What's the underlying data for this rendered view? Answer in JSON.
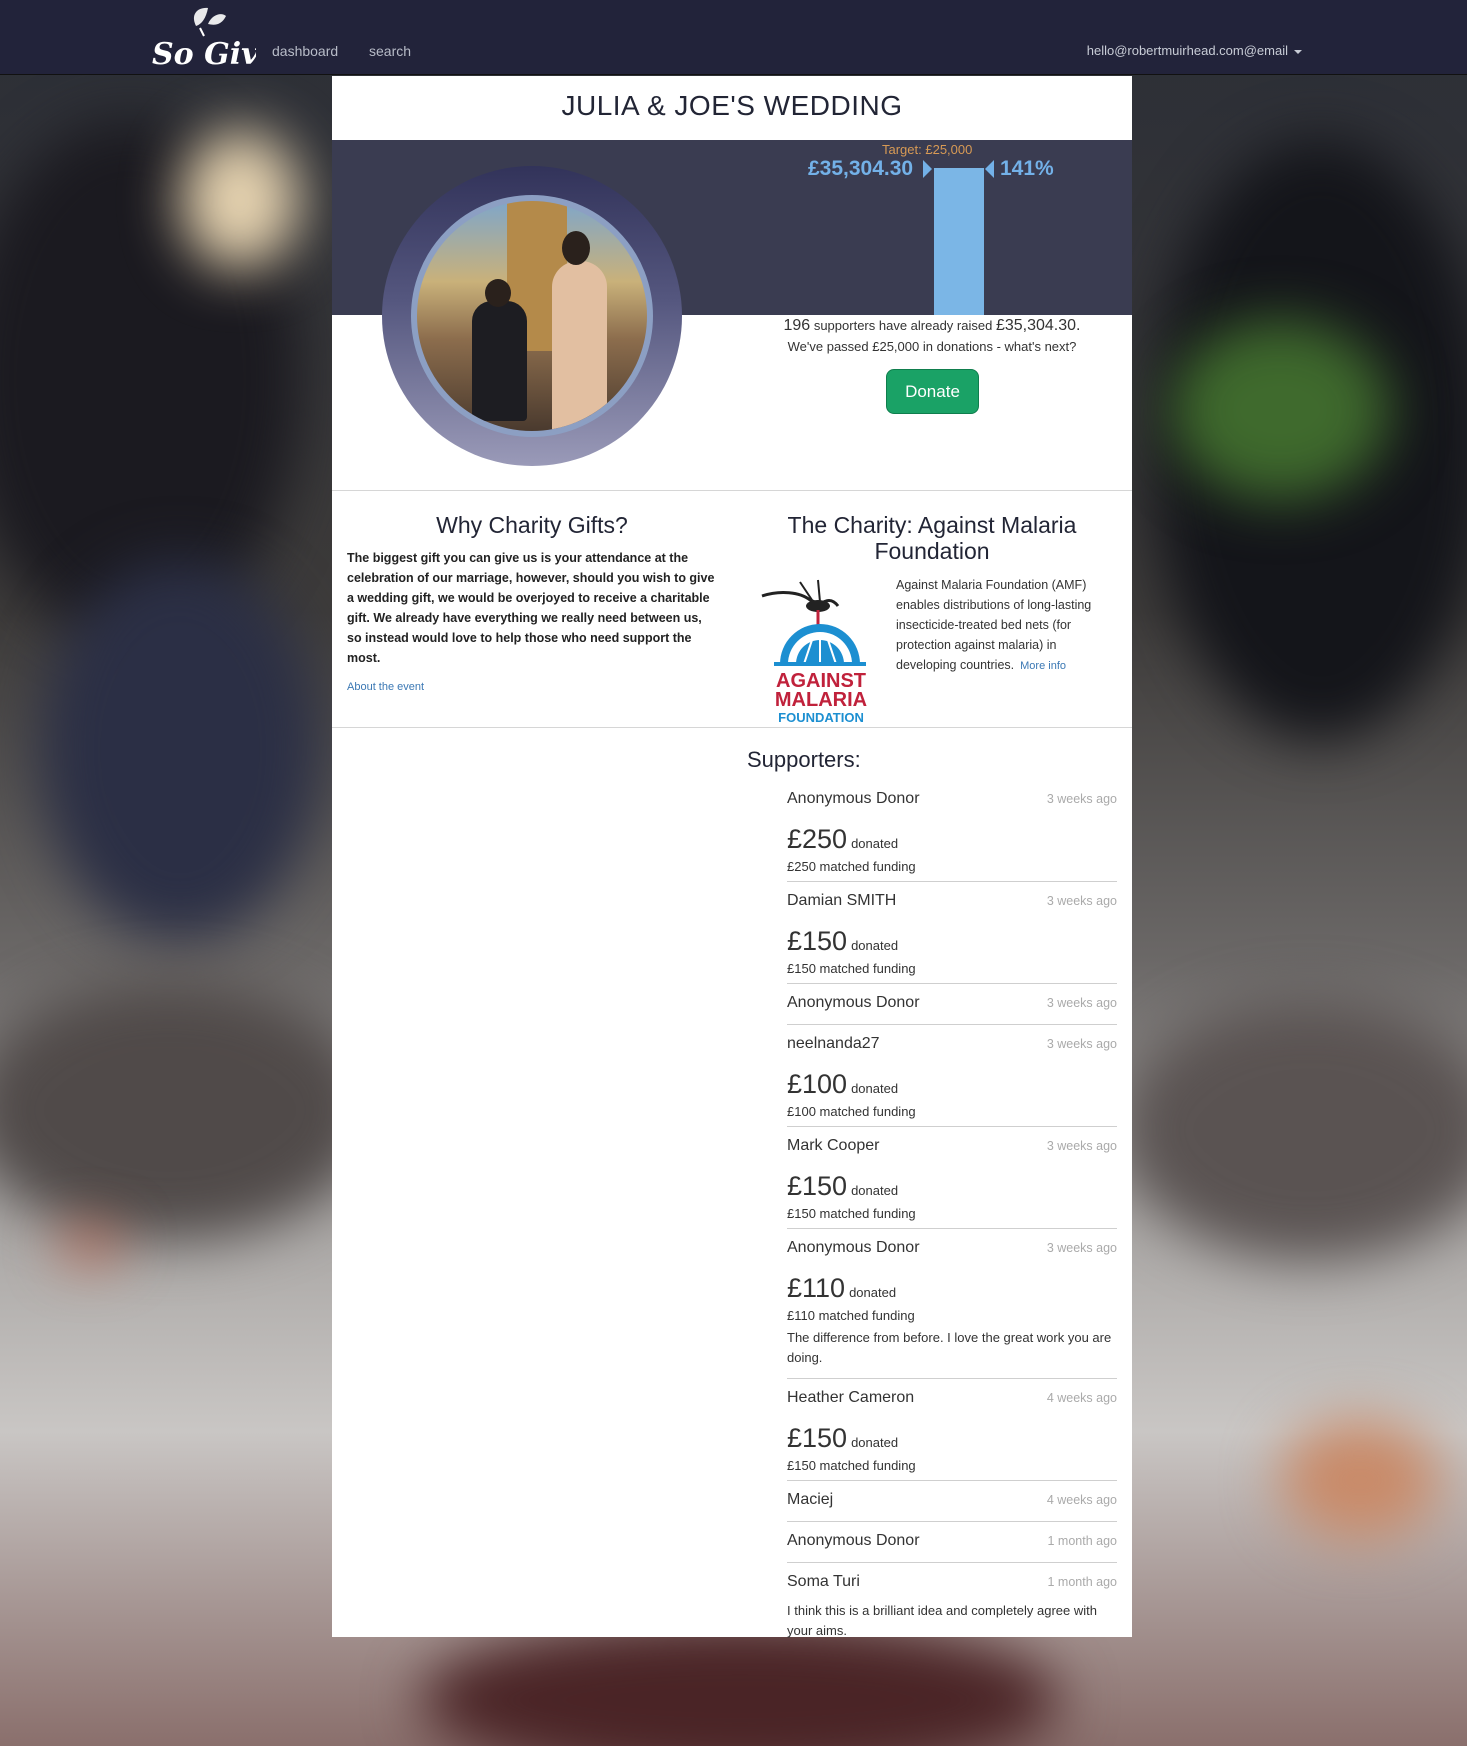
{
  "nav": {
    "logo_text": "So Give",
    "links": [
      "dashboard",
      "search"
    ],
    "user": "hello@robertmuirhead.com@email"
  },
  "event": {
    "title": "JULIA & JOE'S WEDDING",
    "target_label": "Target: £25,000",
    "raised_amount": "£35,304.30",
    "percent": "141%",
    "progress_fraction": 1.41,
    "supporters_count": "196",
    "raised_text_a": "supporters have already raised",
    "raised_text_b": "£35,304.30.",
    "passed_text": "We've passed £25,000 in donations - what's next?",
    "donate_label": "Donate"
  },
  "why": {
    "title": "Why Charity Gifts?",
    "text": "The biggest gift you can give us is your attendance at the celebration of our marriage, however, should you wish to give a wedding gift, we would be overjoyed to receive a charitable gift. We already have everything we really need between us, so instead would love to help those who need support the most.",
    "about_link": "About the event"
  },
  "charity": {
    "title": "The Charity: Against Malaria Foundation",
    "logo_line1": "AGAINST",
    "logo_line2": "MALARIA",
    "logo_line3": "FOUNDATION",
    "description": "Against Malaria Foundation (AMF) enables distributions of long-lasting insecticide-treated bed nets (for protection against malaria) in developing countries.",
    "more_info": "More info"
  },
  "supporters": {
    "title": "Supporters:",
    "donated_label": "donated",
    "items": [
      {
        "name": "Anonymous Donor",
        "time": "3 weeks ago",
        "amount": "£250",
        "match": "£250 matched funding",
        "message": ""
      },
      {
        "name": "Damian SMITH",
        "time": "3 weeks ago",
        "amount": "£150",
        "match": "£150 matched funding",
        "message": ""
      },
      {
        "name": "Anonymous Donor",
        "time": "3 weeks ago",
        "amount": "",
        "match": "",
        "message": ""
      },
      {
        "name": "neelnanda27",
        "time": "3 weeks ago",
        "amount": "£100",
        "match": "£100 matched funding",
        "message": ""
      },
      {
        "name": "Mark Cooper",
        "time": "3 weeks ago",
        "amount": "£150",
        "match": "£150 matched funding",
        "message": ""
      },
      {
        "name": "Anonymous Donor",
        "time": "3 weeks ago",
        "amount": "£110",
        "match": "£110 matched funding",
        "message": "The difference from before. I love the great work you are doing."
      },
      {
        "name": "Heather Cameron",
        "time": "4 weeks ago",
        "amount": "£150",
        "match": "£150 matched funding",
        "message": ""
      },
      {
        "name": "Maciej",
        "time": "4 weeks ago",
        "amount": "",
        "match": "",
        "message": ""
      },
      {
        "name": "Anonymous Donor",
        "time": "1 month ago",
        "amount": "",
        "match": "",
        "message": ""
      },
      {
        "name": "Soma Turi",
        "time": "1 month ago",
        "amount": "",
        "match": "",
        "message": "I think this is a brilliant idea and completely agree with your aims."
      }
    ]
  },
  "colors": {
    "nav_bg": "#22233a",
    "hero_band": "#3a3c51",
    "accent_blue": "#73b1e8",
    "target_orange": "#d79a55",
    "donate_green": "#1aa266",
    "link_blue": "#3b78b4"
  }
}
